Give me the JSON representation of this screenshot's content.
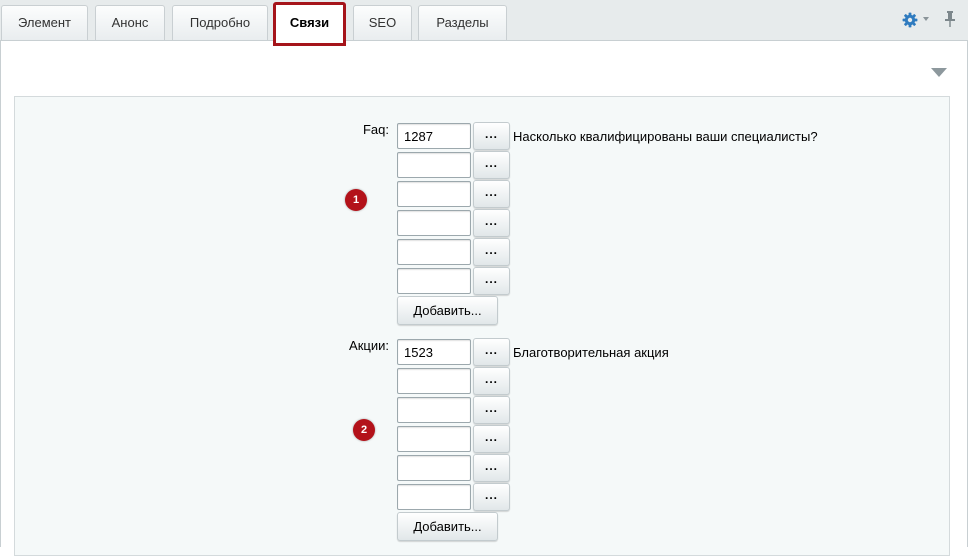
{
  "tabs": [
    {
      "label": "Элемент",
      "active": false
    },
    {
      "label": "Анонс",
      "active": false
    },
    {
      "label": "Подробно",
      "active": false
    },
    {
      "label": "Связи",
      "active": true
    },
    {
      "label": "SEO",
      "active": false
    },
    {
      "label": "Разделы",
      "active": false
    }
  ],
  "toolbar": {
    "settings_icon": "gear-icon",
    "pin_icon": "pin-icon",
    "accent_color": "#2f7bbf",
    "highlight_color": "#a5141a"
  },
  "sections": [
    {
      "label": "Faq:",
      "badge": "1",
      "rows": [
        {
          "value": "1287",
          "button": "...",
          "name": "Насколько квалифицированы ваши специалисты?"
        },
        {
          "value": "",
          "button": "...",
          "name": ""
        },
        {
          "value": "",
          "button": "...",
          "name": ""
        },
        {
          "value": "",
          "button": "...",
          "name": ""
        },
        {
          "value": "",
          "button": "...",
          "name": ""
        },
        {
          "value": "",
          "button": "...",
          "name": ""
        }
      ],
      "add_label": "Добавить..."
    },
    {
      "label": "Акции:",
      "badge": "2",
      "rows": [
        {
          "value": "1523",
          "button": "...",
          "name": "Благотворительная акция"
        },
        {
          "value": "",
          "button": "...",
          "name": ""
        },
        {
          "value": "",
          "button": "...",
          "name": ""
        },
        {
          "value": "",
          "button": "...",
          "name": ""
        },
        {
          "value": "",
          "button": "...",
          "name": ""
        },
        {
          "value": "",
          "button": "...",
          "name": ""
        }
      ],
      "add_label": "Добавить..."
    }
  ],
  "badge_color": "#b3121a"
}
